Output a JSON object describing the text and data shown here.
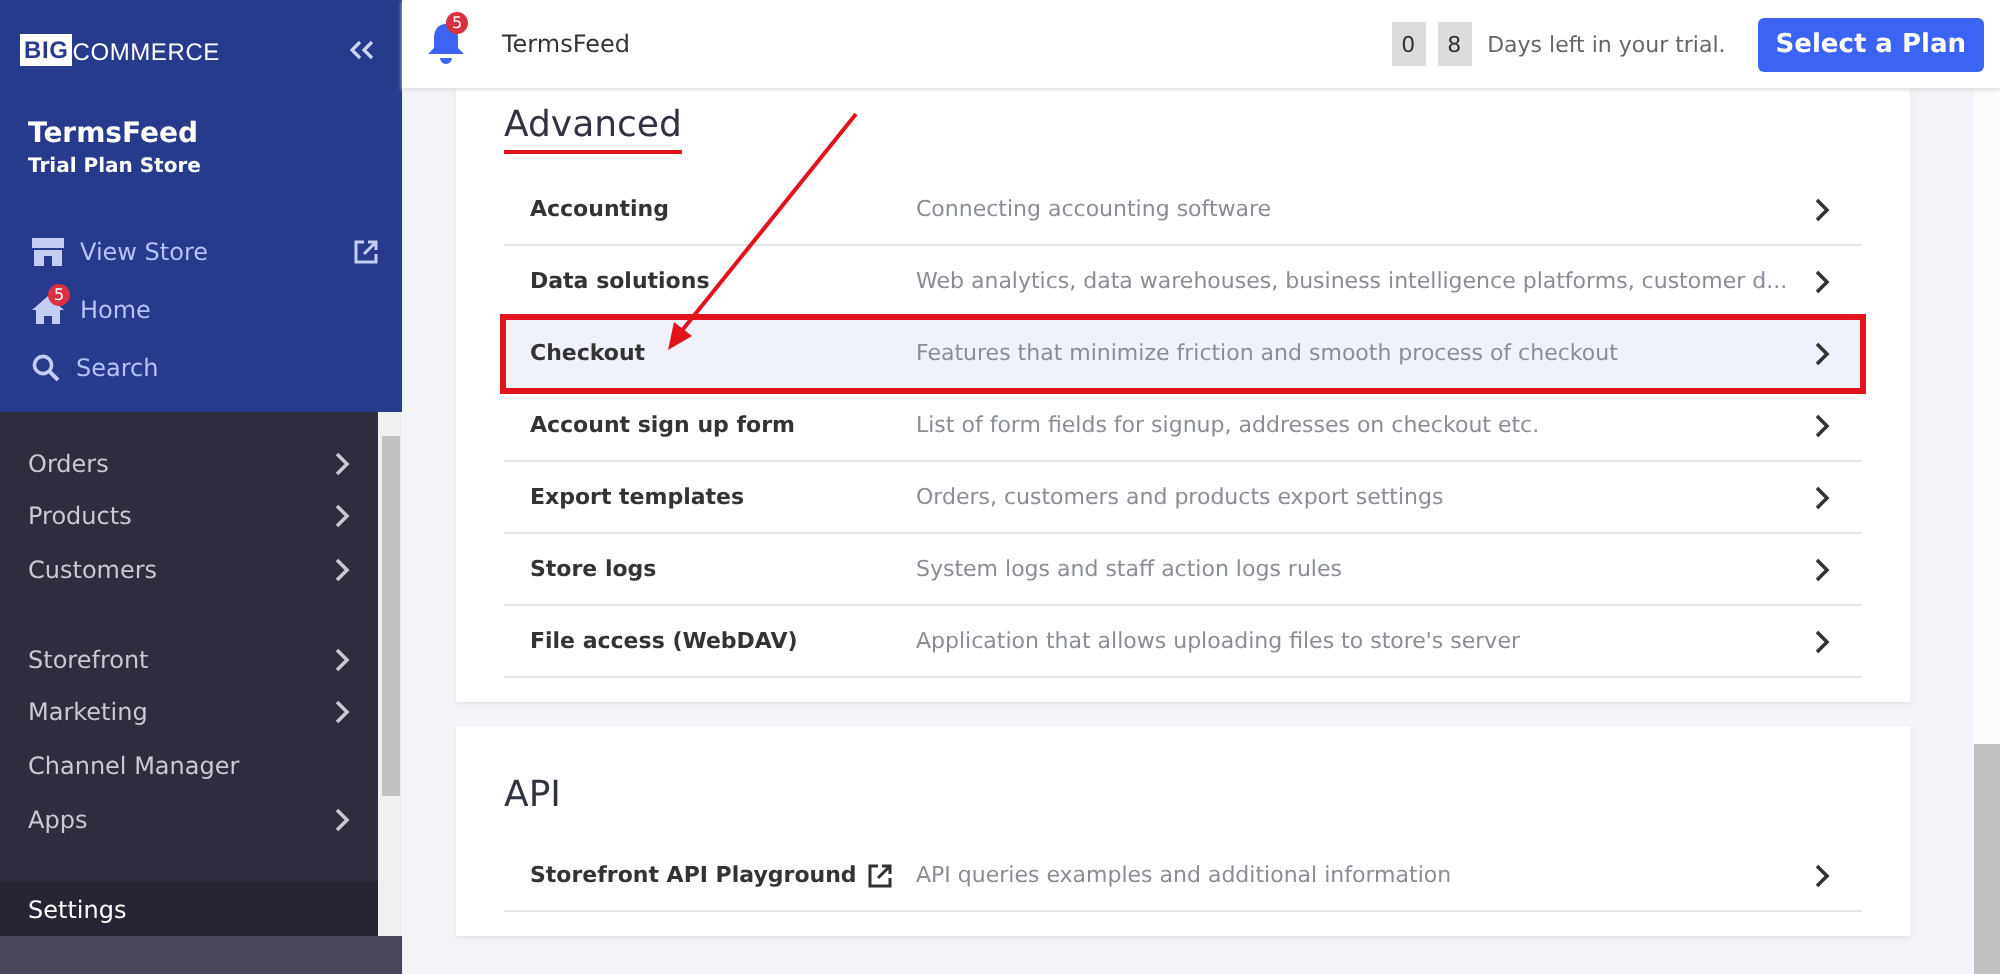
{
  "sidebar": {
    "logo": {
      "big": "BIG",
      "rest": "COMMERCE"
    },
    "store_name": "TermsFeed",
    "plan": "Trial Plan Store",
    "quick_links": [
      {
        "label": "View Store",
        "external": true
      },
      {
        "label": "Home",
        "external": false,
        "badge": "5"
      },
      {
        "label": "Search",
        "external": false
      }
    ],
    "groups": [
      [
        {
          "label": "Orders",
          "has_submenu": true,
          "selected": false
        },
        {
          "label": "Products",
          "has_submenu": true,
          "selected": false
        },
        {
          "label": "Customers",
          "has_submenu": true,
          "selected": false
        }
      ],
      [
        {
          "label": "Storefront",
          "has_submenu": true,
          "selected": false
        },
        {
          "label": "Marketing",
          "has_submenu": true,
          "selected": false
        },
        {
          "label": "Channel Manager",
          "has_submenu": false,
          "selected": false
        },
        {
          "label": "Apps",
          "has_submenu": true,
          "selected": false
        }
      ],
      [
        {
          "label": "Settings",
          "has_submenu": false,
          "selected": true
        }
      ]
    ]
  },
  "top_bar": {
    "notification_count": "5",
    "store_name": "TermsFeed",
    "trial_digits": [
      "0",
      "8"
    ],
    "trial_text": "Days left in your trial.",
    "cta": "Select a Plan"
  },
  "sections": [
    {
      "title": "Advanced",
      "underlined": true,
      "rows": [
        {
          "label": "Accounting",
          "description": "Connecting accounting software",
          "external": false,
          "highlighted": false
        },
        {
          "label": "Data solutions",
          "description": "Web analytics, data warehouses, business intelligence platforms, customer d...",
          "external": false,
          "highlighted": false
        },
        {
          "label": "Checkout",
          "description": "Features that minimize friction and smooth process of checkout",
          "external": false,
          "highlighted": true
        },
        {
          "label": "Account sign up form",
          "description": "List of form fields for signup, addresses on checkout etc.",
          "external": false,
          "highlighted": false
        },
        {
          "label": "Export templates",
          "description": "Orders, customers and products export settings",
          "external": false,
          "highlighted": false
        },
        {
          "label": "Store logs",
          "description": "System logs and staff action logs rules",
          "external": false,
          "highlighted": false
        },
        {
          "label": "File access (WebDAV)",
          "description": "Application that allows uploading files to store's server",
          "external": false,
          "highlighted": false
        }
      ]
    },
    {
      "title": "API",
      "underlined": false,
      "rows": [
        {
          "label": "Storefront API Playground",
          "description": "API queries examples and additional information",
          "external": true,
          "highlighted": false
        }
      ]
    }
  ]
}
